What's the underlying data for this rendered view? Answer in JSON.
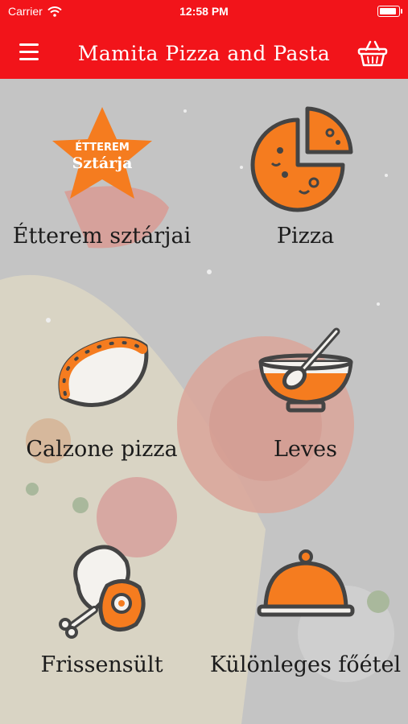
{
  "status_bar": {
    "carrier": "Carrier",
    "time": "12:58 PM"
  },
  "header": {
    "title": "Mamita Pizza and Pasta",
    "menu_icon": "hamburger-menu-icon",
    "cart_icon": "basket-icon"
  },
  "categories": [
    {
      "label": "Étterem sztárjai",
      "icon": "star-badge-icon",
      "badge_line1": "ÉTTEREM",
      "badge_line2": "Sztárja"
    },
    {
      "label": "Pizza",
      "icon": "pizza-icon"
    },
    {
      "label": "Calzone pizza",
      "icon": "calzone-icon"
    },
    {
      "label": "Leves",
      "icon": "soup-bowl-icon"
    },
    {
      "label": "Frissensült",
      "icon": "meat-egg-icon"
    },
    {
      "label": "Különleges főétel",
      "icon": "cloche-icon"
    }
  ],
  "colors": {
    "header": "#f2141a",
    "accent": "#f57c1f",
    "outline": "#444444"
  }
}
